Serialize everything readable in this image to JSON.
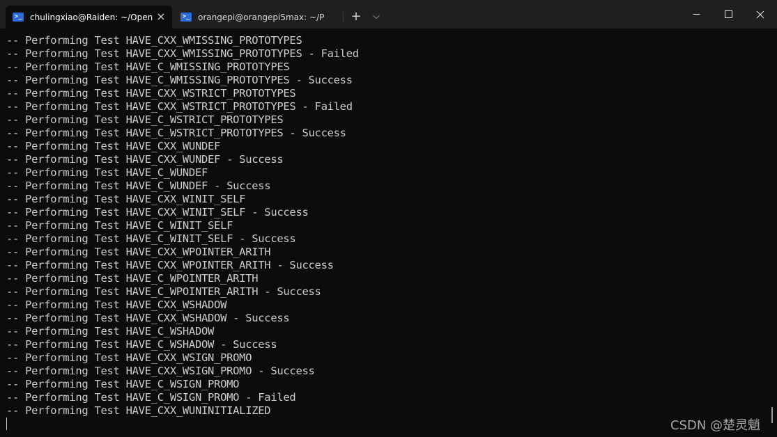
{
  "tabs": [
    {
      "title": "chulingxiao@Raiden: ~/Open",
      "icon": "powershell-icon",
      "active": true
    },
    {
      "title": "orangepi@orangepi5max: ~/P",
      "icon": "powershell-icon",
      "active": false
    }
  ],
  "toolbar": {
    "new_tab": "+",
    "dropdown": "⌵"
  },
  "window": {
    "minimize": "—",
    "maximize": "☐",
    "close": "✕"
  },
  "terminal_lines": [
    "-- Performing Test HAVE_CXX_WMISSING_PROTOTYPES",
    "-- Performing Test HAVE_CXX_WMISSING_PROTOTYPES - Failed",
    "-- Performing Test HAVE_C_WMISSING_PROTOTYPES",
    "-- Performing Test HAVE_C_WMISSING_PROTOTYPES - Success",
    "-- Performing Test HAVE_CXX_WSTRICT_PROTOTYPES",
    "-- Performing Test HAVE_CXX_WSTRICT_PROTOTYPES - Failed",
    "-- Performing Test HAVE_C_WSTRICT_PROTOTYPES",
    "-- Performing Test HAVE_C_WSTRICT_PROTOTYPES - Success",
    "-- Performing Test HAVE_CXX_WUNDEF",
    "-- Performing Test HAVE_CXX_WUNDEF - Success",
    "-- Performing Test HAVE_C_WUNDEF",
    "-- Performing Test HAVE_C_WUNDEF - Success",
    "-- Performing Test HAVE_CXX_WINIT_SELF",
    "-- Performing Test HAVE_CXX_WINIT_SELF - Success",
    "-- Performing Test HAVE_C_WINIT_SELF",
    "-- Performing Test HAVE_C_WINIT_SELF - Success",
    "-- Performing Test HAVE_CXX_WPOINTER_ARITH",
    "-- Performing Test HAVE_CXX_WPOINTER_ARITH - Success",
    "-- Performing Test HAVE_C_WPOINTER_ARITH",
    "-- Performing Test HAVE_C_WPOINTER_ARITH - Success",
    "-- Performing Test HAVE_CXX_WSHADOW",
    "-- Performing Test HAVE_CXX_WSHADOW - Success",
    "-- Performing Test HAVE_C_WSHADOW",
    "-- Performing Test HAVE_C_WSHADOW - Success",
    "-- Performing Test HAVE_CXX_WSIGN_PROMO",
    "-- Performing Test HAVE_CXX_WSIGN_PROMO - Success",
    "-- Performing Test HAVE_C_WSIGN_PROMO",
    "-- Performing Test HAVE_C_WSIGN_PROMO - Failed",
    "-- Performing Test HAVE_CXX_WUNINITIALIZED"
  ],
  "watermark": "CSDN @楚灵魈",
  "colors": {
    "terminal_bg": "#0c0c0c",
    "titlebar_bg": "#1f1f1f",
    "text": "#cccccc",
    "ps_blue": "#2b6bd6"
  }
}
